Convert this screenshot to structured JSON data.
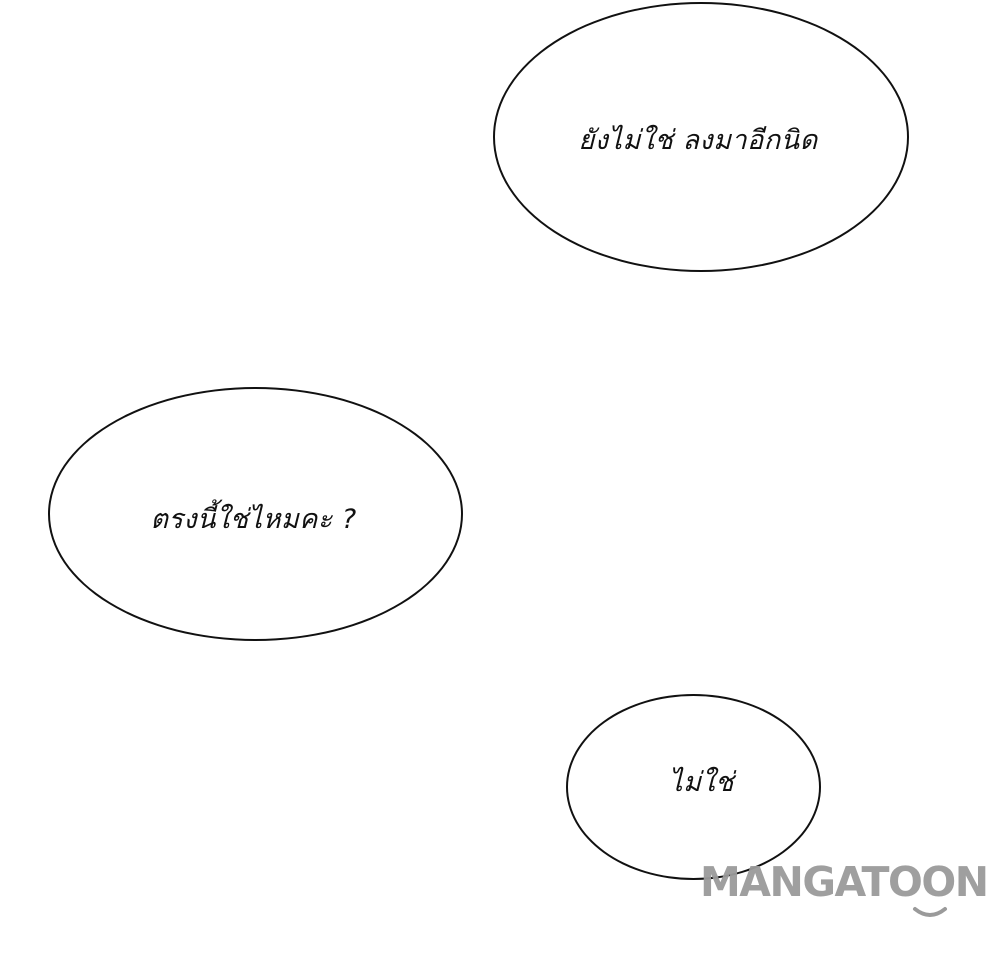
{
  "dialogue": [
    {
      "text": "ยังไม่ใช่ ลงมาอีกนิด"
    },
    {
      "text": "ตรงนี้ใช่ไหมคะ ?"
    },
    {
      "text": "ไม่ใช่"
    }
  ],
  "watermark": {
    "text": "MANGATOON",
    "color": "#9a9a9a"
  }
}
